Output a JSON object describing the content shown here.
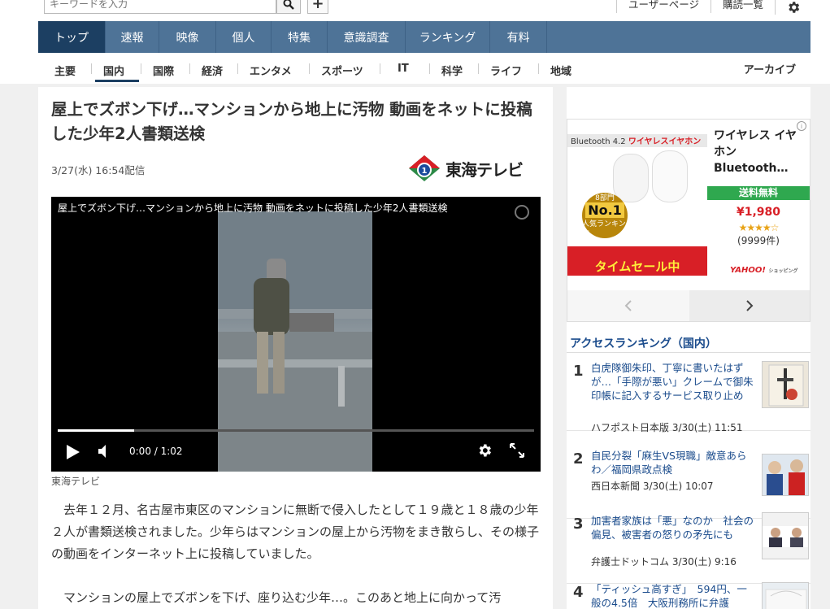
{
  "search": {
    "placeholder": "キーワードを入力"
  },
  "user_links": [
    "ユーザーページ",
    "購読一覧"
  ],
  "main_nav": [
    "トップ",
    "速報",
    "映像",
    "個人",
    "特集",
    "意識調査",
    "ランキング",
    "有料"
  ],
  "sub_nav": [
    "主要",
    "国内",
    "国際",
    "経済",
    "エンタメ",
    "スポーツ",
    "IT",
    "科学",
    "ライフ",
    "地域"
  ],
  "archive": "アーカイブ",
  "article": {
    "title": "屋上でズボン下げ…マンションから地上に汚物 動画をネットに投稿した少年2人書類送検",
    "date": "3/27(水) 16:54配信",
    "publisher_logo": "東海テレビ",
    "video": {
      "title": "屋上でズボン下げ…マンションから地上に汚物 動画をネットに投稿した少年2人書類送検",
      "time": "0:00 / 1:02",
      "progress": 0.16
    },
    "video_credit": "東海テレビ",
    "body": [
      "去年１２月、名古屋市東区のマンションに無断で侵入したとして１９歳と１８歳の少年２人が書類送検されました。少年らはマンションの屋上から汚物をまき散らし、その様子の動画をインターネット上に投稿していました。",
      "マンションの屋上でズボンを下げ、座り込む少年…。このあと地上に向かって汚"
    ]
  },
  "ad": {
    "banner_left": "Bluetooth 4.2",
    "banner_right": "ワイヤレスイヤホン",
    "medal_top": "8部門",
    "medal_no1": "No.1",
    "medal_bottom": "人気ランキング",
    "sale": "タイムセール中",
    "title": "ワイヤレス イヤホン Bluetooth…",
    "shipping": "送料無料",
    "price": "¥1,980",
    "stars": "★★★★☆",
    "reviews": "(9999件)",
    "yahoo": "YAHOO!",
    "yahoo_sub": "ショッピング"
  },
  "ranking": {
    "heading": "アクセスランキング（国内）",
    "items": [
      {
        "num": "1",
        "title": "白虎隊御朱印、丁寧に書いたはずが…「手際が悪い」クレームで御朱印帳に記入するサービス取り止め",
        "source": "ハフポスト日本版 3/30(土) 11:51"
      },
      {
        "num": "2",
        "title": "自民分裂「麻生VS現職」敵意あらわ／福岡県政点検",
        "source": "西日本新聞 3/30(土) 10:07"
      },
      {
        "num": "3",
        "title": "加害者家族は「悪」なのか　社会の偏見、被害者の怒りの矛先にも",
        "source": "弁護士ドットコム 3/30(土) 9:16"
      },
      {
        "num": "4",
        "title": "「ティッシュ高すぎ」　594円、一般の4.5倍　大阪刑務所に弁護",
        "source": ""
      }
    ]
  },
  "colors": {
    "nav_bg": "#4e7397",
    "nav_active": "#1c3f62",
    "link": "#1a4b8c",
    "ad_green": "#2fa84f",
    "ad_red": "#d81f26"
  }
}
